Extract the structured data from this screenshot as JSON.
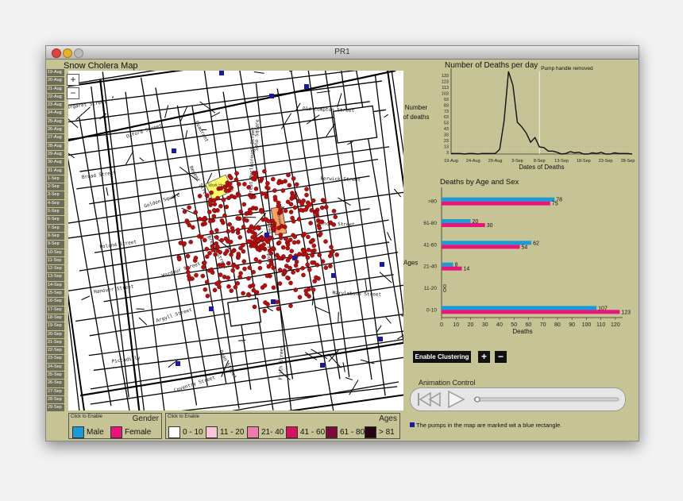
{
  "window": {
    "title": "PR1"
  },
  "map": {
    "title": "Snow Cholera Map",
    "zoom_in": "+",
    "zoom_out": "−",
    "dates": [
      "19-Aug",
      "20-Aug",
      "21-Aug",
      "22-Aug",
      "23-Aug",
      "24-Aug",
      "25-Aug",
      "26-Aug",
      "27-Aug",
      "28-Aug",
      "29-Aug",
      "30-Aug",
      "31-Aug",
      "1-Sep",
      "2-Sep",
      "3-Sep",
      "4-Sep",
      "5-Sep",
      "6-Sep",
      "7-Sep",
      "8-Sep",
      "9-Sep",
      "10-Sep",
      "11-Sep",
      "12-Sep",
      "13-Sep",
      "14-Sep",
      "15-Sep",
      "16-Sep",
      "17-Sep",
      "18-Sep",
      "19-Sep",
      "20-Sep",
      "21-Sep",
      "22-Sep",
      "23-Sep",
      "24-Sep",
      "25-Sep",
      "26-Sep",
      "27-Sep",
      "28-Sep",
      "29-Sep"
    ],
    "street_labels": [
      "Margaret Street",
      "Oxford Street",
      "Regent Street",
      "Great Marlborough Street",
      "Princes Street",
      "Hanover Street",
      "Argyll Street",
      "Dean Street",
      "Frith Street",
      "Old Compton Street",
      "Broad Street",
      "Golden Square",
      "Brewer Street",
      "Conduit Street",
      "Marylebone Street",
      "Piccadilly",
      "Coventry Street",
      "Quadrant",
      "Soho Square",
      "Berwick Street",
      "Poland Street",
      "Wardour Street"
    ],
    "work_house": "Work House",
    "brewery": "Brewery"
  },
  "gender_legend": {
    "hint": "Click to Enable",
    "title": "Gender",
    "items": [
      {
        "label": "Male",
        "color": "#1a9ad6"
      },
      {
        "label": "Female",
        "color": "#e8157a"
      }
    ]
  },
  "age_legend": {
    "hint": "Click to Enable",
    "title": "Ages",
    "items": [
      {
        "label": "0 - 10",
        "color": "#ffffff"
      },
      {
        "label": "11 - 20",
        "color": "#f7c6d8"
      },
      {
        "label": "21- 40",
        "color": "#f07aa8"
      },
      {
        "label": "41 - 60",
        "color": "#d4135f"
      },
      {
        "label": "61 - 80",
        "color": "#7d0b35"
      },
      {
        "label": "> 81",
        "color": "#2a0310"
      }
    ]
  },
  "controls": {
    "clustering": "Enable Clustering",
    "plus": "+",
    "minus": "−",
    "animation_label": "Animation Control"
  },
  "pump_note": "The pumps in the map are marked wit a blue rectangle.",
  "chart_data": [
    {
      "type": "line",
      "title": "Number of Deaths per day",
      "xlabel": "Dates of Deaths",
      "ylabel": "Number of deaths",
      "annotation": "Pump handle removed",
      "x_ticks": [
        "19-Aug",
        "24-Aug",
        "29-Aug",
        "3-Sep",
        "8-Sep",
        "13-Sep",
        "18-Sep",
        "23-Sep",
        "28-Sep"
      ],
      "y_ticks": [
        3,
        13,
        23,
        33,
        43,
        53,
        63,
        73,
        83,
        93,
        103,
        113,
        123,
        133
      ],
      "ylim": [
        0,
        140
      ],
      "x_days": [
        0,
        1,
        2,
        3,
        4,
        5,
        6,
        7,
        8,
        9,
        10,
        11,
        12,
        13,
        14,
        15,
        16,
        17,
        18,
        19,
        20,
        21,
        22,
        23,
        24,
        25,
        26,
        27,
        28,
        29,
        30,
        31,
        32,
        33,
        34,
        35,
        36,
        37,
        38,
        39,
        40,
        41
      ],
      "values": [
        1,
        1,
        1,
        0,
        1,
        1,
        0,
        1,
        1,
        1,
        1,
        8,
        56,
        143,
        116,
        54,
        46,
        36,
        20,
        28,
        12,
        11,
        5,
        5,
        3,
        0,
        1,
        4,
        2,
        3,
        0,
        0,
        2,
        1,
        3,
        0,
        0,
        2,
        1,
        1,
        1,
        0
      ],
      "annotation_day": 20
    },
    {
      "type": "bar",
      "title": "Deaths by Age and Sex",
      "xlabel": "Deaths",
      "ylabel": "Ages",
      "categories": [
        ">80",
        "61-80",
        "41-60",
        "21-40",
        "11-20",
        "0-10"
      ],
      "series": [
        {
          "color": "#1a9ad6",
          "values": [
            78,
            20,
            62,
            8,
            0,
            107
          ]
        },
        {
          "color": "#e8157a",
          "values": [
            75,
            30,
            54,
            14,
            0,
            123
          ]
        }
      ],
      "x_ticks": [
        0,
        10,
        20,
        30,
        40,
        50,
        60,
        70,
        80,
        90,
        100,
        110,
        120
      ],
      "xlim": [
        0,
        125
      ]
    }
  ]
}
